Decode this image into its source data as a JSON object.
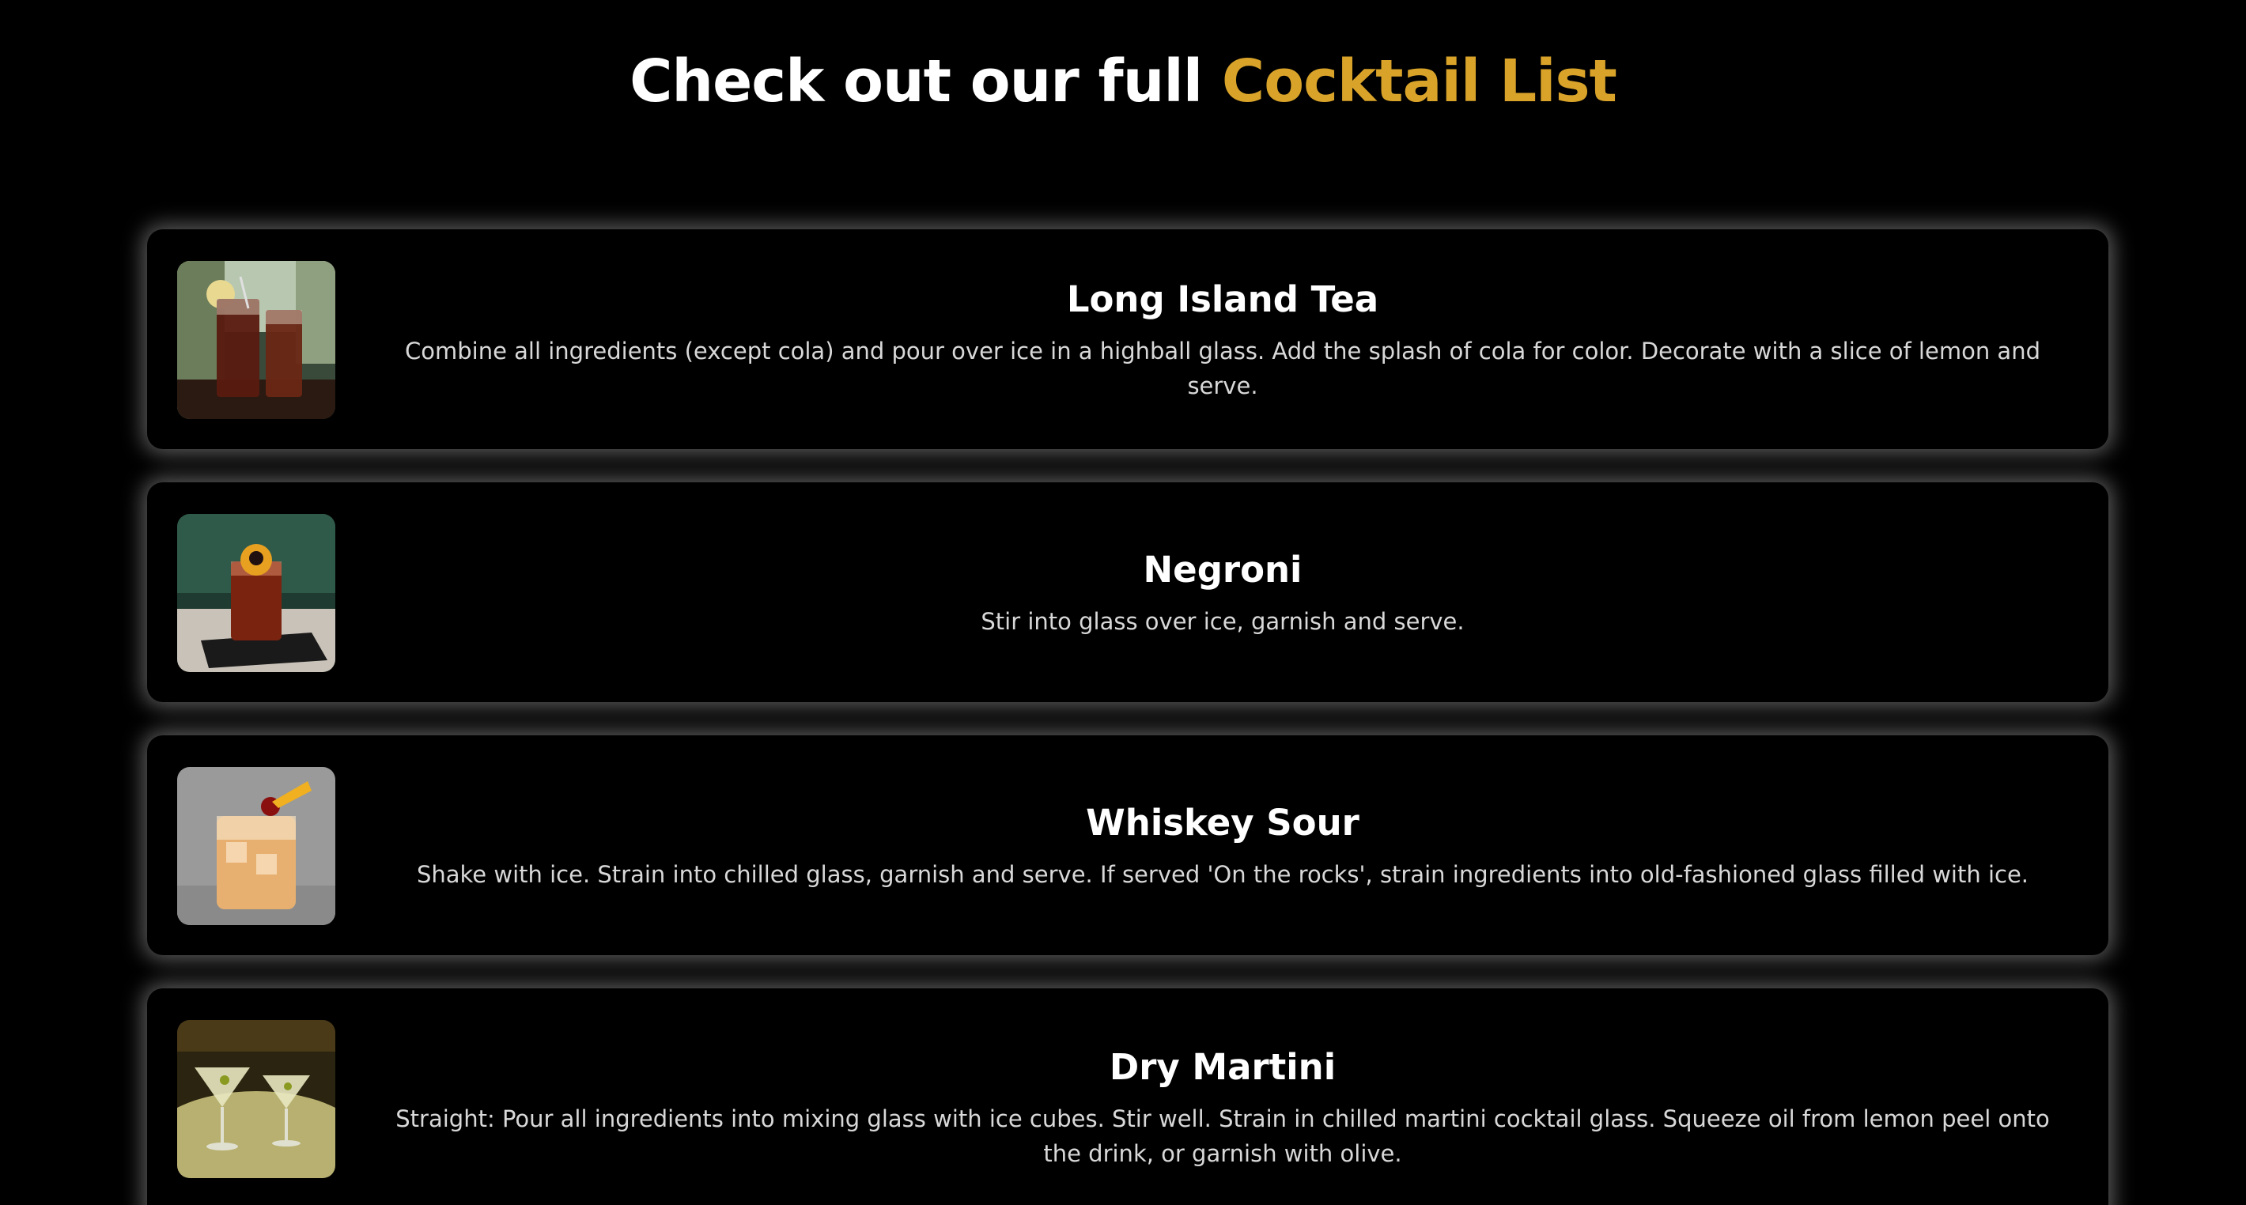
{
  "header": {
    "title_prefix": "Check out our full",
    "title_accent": "Cocktail List",
    "accent_color": "#d9a32a"
  },
  "cocktails": [
    {
      "name": "Long Island Tea",
      "instructions": "Combine all ingredients (except cola) and pour over ice in a highball glass. Add the splash of cola for color. Decorate with a slice of lemon and serve.",
      "image_icon": "long-island-tea-photo"
    },
    {
      "name": "Negroni",
      "instructions": "Stir into glass over ice, garnish and serve.",
      "image_icon": "negroni-photo"
    },
    {
      "name": "Whiskey Sour",
      "instructions": "Shake with ice. Strain into chilled glass, garnish and serve. If served 'On the rocks', strain ingredients into old-fashioned glass filled with ice.",
      "image_icon": "whiskey-sour-photo"
    },
    {
      "name": "Dry Martini",
      "instructions": "Straight: Pour all ingredients into mixing glass with ice cubes. Stir well. Strain in chilled martini cocktail glass. Squeeze oil from lemon peel onto the drink, or garnish with olive.",
      "image_icon": "dry-martini-photo"
    }
  ]
}
